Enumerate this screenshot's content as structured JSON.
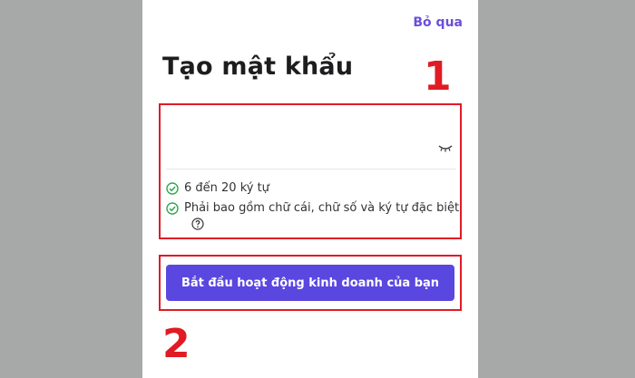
{
  "skip_label": "Bỏ qua",
  "title": "Tạo mật khẩu",
  "password": {
    "value": "",
    "placeholder": ""
  },
  "rules": [
    "6 đến 20 ký tự",
    "Phải bao gồm chữ cái, chữ số và ký tự đặc biệt"
  ],
  "cta_label": "Bắt đầu hoạt động kinh doanh của bạn",
  "annotations": {
    "step1": "1",
    "step2": "2"
  },
  "icons": {
    "eye": "eye-closed-icon",
    "check": "check-circle-icon",
    "help": "question-circle-icon"
  },
  "colors": {
    "accent": "#5a47e0",
    "link": "#6b4fd8",
    "check": "#2fa84f",
    "annotation": "#e01b24"
  }
}
